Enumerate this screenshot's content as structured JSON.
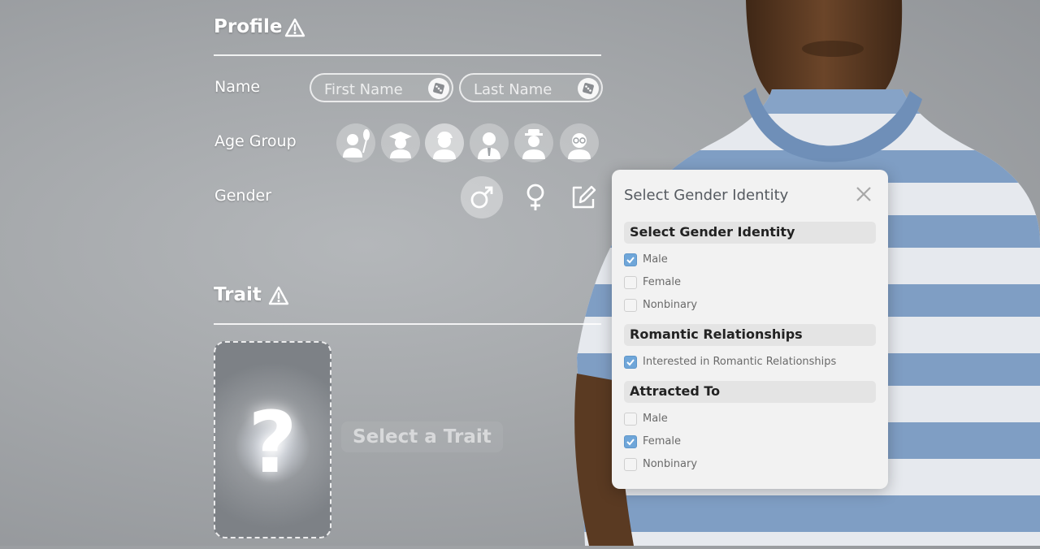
{
  "profile": {
    "title": "Profile",
    "name_label": "Name",
    "first_name": {
      "value": "",
      "placeholder": "First Name"
    },
    "last_name": {
      "value": "",
      "placeholder": "Last Name"
    },
    "age_group_label": "Age Group",
    "age_groups": [
      "baby-icon",
      "graduate-icon",
      "young-adult-icon",
      "adult-icon",
      "elder-hat-icon",
      "elder-glasses-icon"
    ],
    "age_selected": 2,
    "gender_label": "Gender",
    "gender_selected": "male"
  },
  "trait": {
    "title": "Trait",
    "card_symbol": "?",
    "select_label": "Select a Trait"
  },
  "popup": {
    "title": "Select Gender Identity",
    "groups": [
      {
        "header": "Select Gender Identity",
        "options": [
          {
            "label": "Male",
            "checked": true
          },
          {
            "label": "Female",
            "checked": false
          },
          {
            "label": "Nonbinary",
            "checked": false
          }
        ]
      },
      {
        "header": "Romantic Relationships",
        "options": [
          {
            "label": "Interested in Romantic Relationships",
            "checked": true
          }
        ]
      },
      {
        "header": "Attracted To",
        "options": [
          {
            "label": "Male",
            "checked": false
          },
          {
            "label": "Female",
            "checked": true
          },
          {
            "label": "Nonbinary",
            "checked": false
          }
        ]
      }
    ]
  },
  "colors": {
    "checkbox_checked": "#6fa6d9",
    "popup_bg": "#f2f2f2",
    "shirt_blue": "#7f9ec4",
    "shirt_white": "#e6e9ee",
    "skin": "#5a3a22"
  }
}
